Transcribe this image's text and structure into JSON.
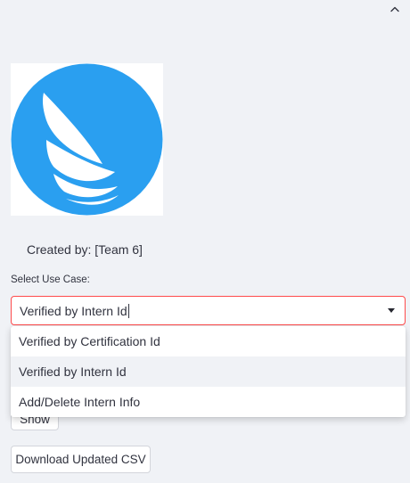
{
  "sidebar": {
    "created_by": "Created by: [Team 6]",
    "select_label": "Select Use Case:",
    "select_value": "Verified by Intern Id",
    "options": [
      "Verified by Certification Id",
      "Verified by Intern Id",
      "Add/Delete Intern Info"
    ],
    "highlighted_option": 1,
    "show_button": "Show",
    "download_button": "Download Updated CSV"
  },
  "colors": {
    "logo_blue": "#2a9ff0",
    "focus_border": "#ff4b4b",
    "background": "#f0f2f6"
  },
  "icons": {
    "collapse": "chevron-up-icon",
    "dropdown": "caret-down-icon",
    "logo": "sail-logo-icon"
  }
}
